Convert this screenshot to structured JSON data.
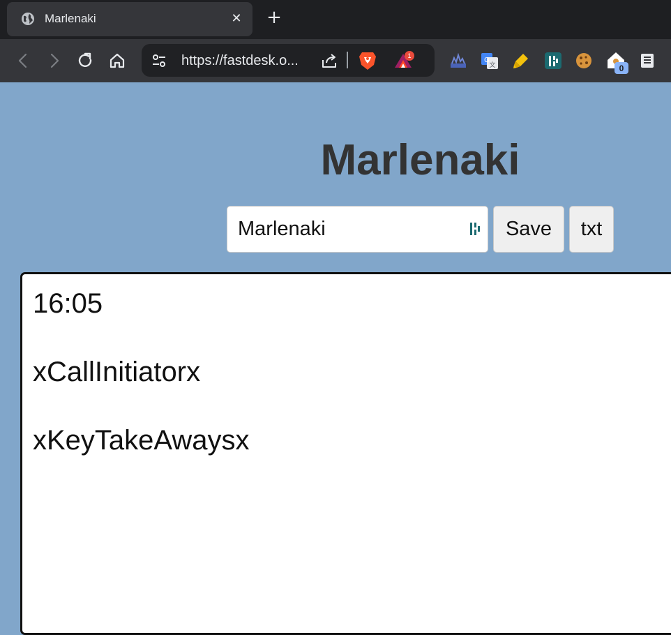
{
  "browser": {
    "tab": {
      "title": "Marlenaki",
      "close_icon": "close-icon",
      "favicon_icon": "globe-icon"
    },
    "new_tab_label": "+",
    "address": {
      "url": "https://fastdesk.o..."
    },
    "bat_badge": "1",
    "extension_badge": "0",
    "colors": {
      "tab_bar": "#1e1f22",
      "toolbar": "#35363a",
      "address_bar": "#202124",
      "brave_orange": "#fb542b"
    }
  },
  "page": {
    "title": "Marlenaki",
    "name_field_value": "Marlenaki",
    "save_label": "Save",
    "txt_label": "txt",
    "background": "#81a6ca",
    "editor_lines": [
      "16:05",
      "xCallInitiatorx",
      "xKeyTakeAwaysx"
    ]
  }
}
